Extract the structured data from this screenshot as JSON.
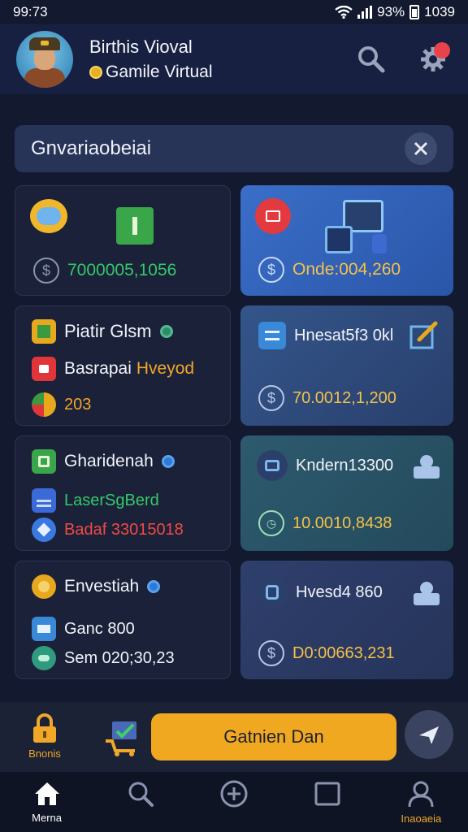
{
  "status": {
    "time": "99:73",
    "battery": "93%",
    "clock": "1039"
  },
  "header": {
    "name": "Birthis Vioval",
    "subtitle": "Gamile Virtual"
  },
  "search": {
    "text": "Gnvariaobeiai"
  },
  "cards": {
    "c1": {
      "amount": "7000005,1056"
    },
    "c2": {
      "amount": "Onde:004,260"
    },
    "c3": {
      "title": "Piatir Glsm",
      "line1_a": "Basrapai",
      "line1_b": "Hveyod",
      "line2": "203"
    },
    "c4": {
      "title": "Hnesat5f3 0kl",
      "amount": "70.0012,1,200"
    },
    "c5": {
      "title": "Gharidenah",
      "line1": "LaserSgBerd",
      "line2": "Badaf 33015018"
    },
    "c6": {
      "title": "Kndern13300",
      "amount": "10.0010,8438"
    },
    "c7": {
      "title": "Envestiah",
      "line1": "Ganc 800",
      "line2": "Sem 020;30,23"
    },
    "c8": {
      "title": "Hvesd4 860",
      "amount": "D0:00663,231"
    }
  },
  "action_bar": {
    "bonus_label": "Bnonis",
    "cta_label": "Gatnien Dan"
  },
  "bottom_nav": {
    "home": "Merna",
    "profile": "Inaoaeia"
  },
  "colors": {
    "accent": "#f0a820",
    "green": "#35c86a",
    "red": "#f04a44",
    "orange": "#f0a72a"
  }
}
